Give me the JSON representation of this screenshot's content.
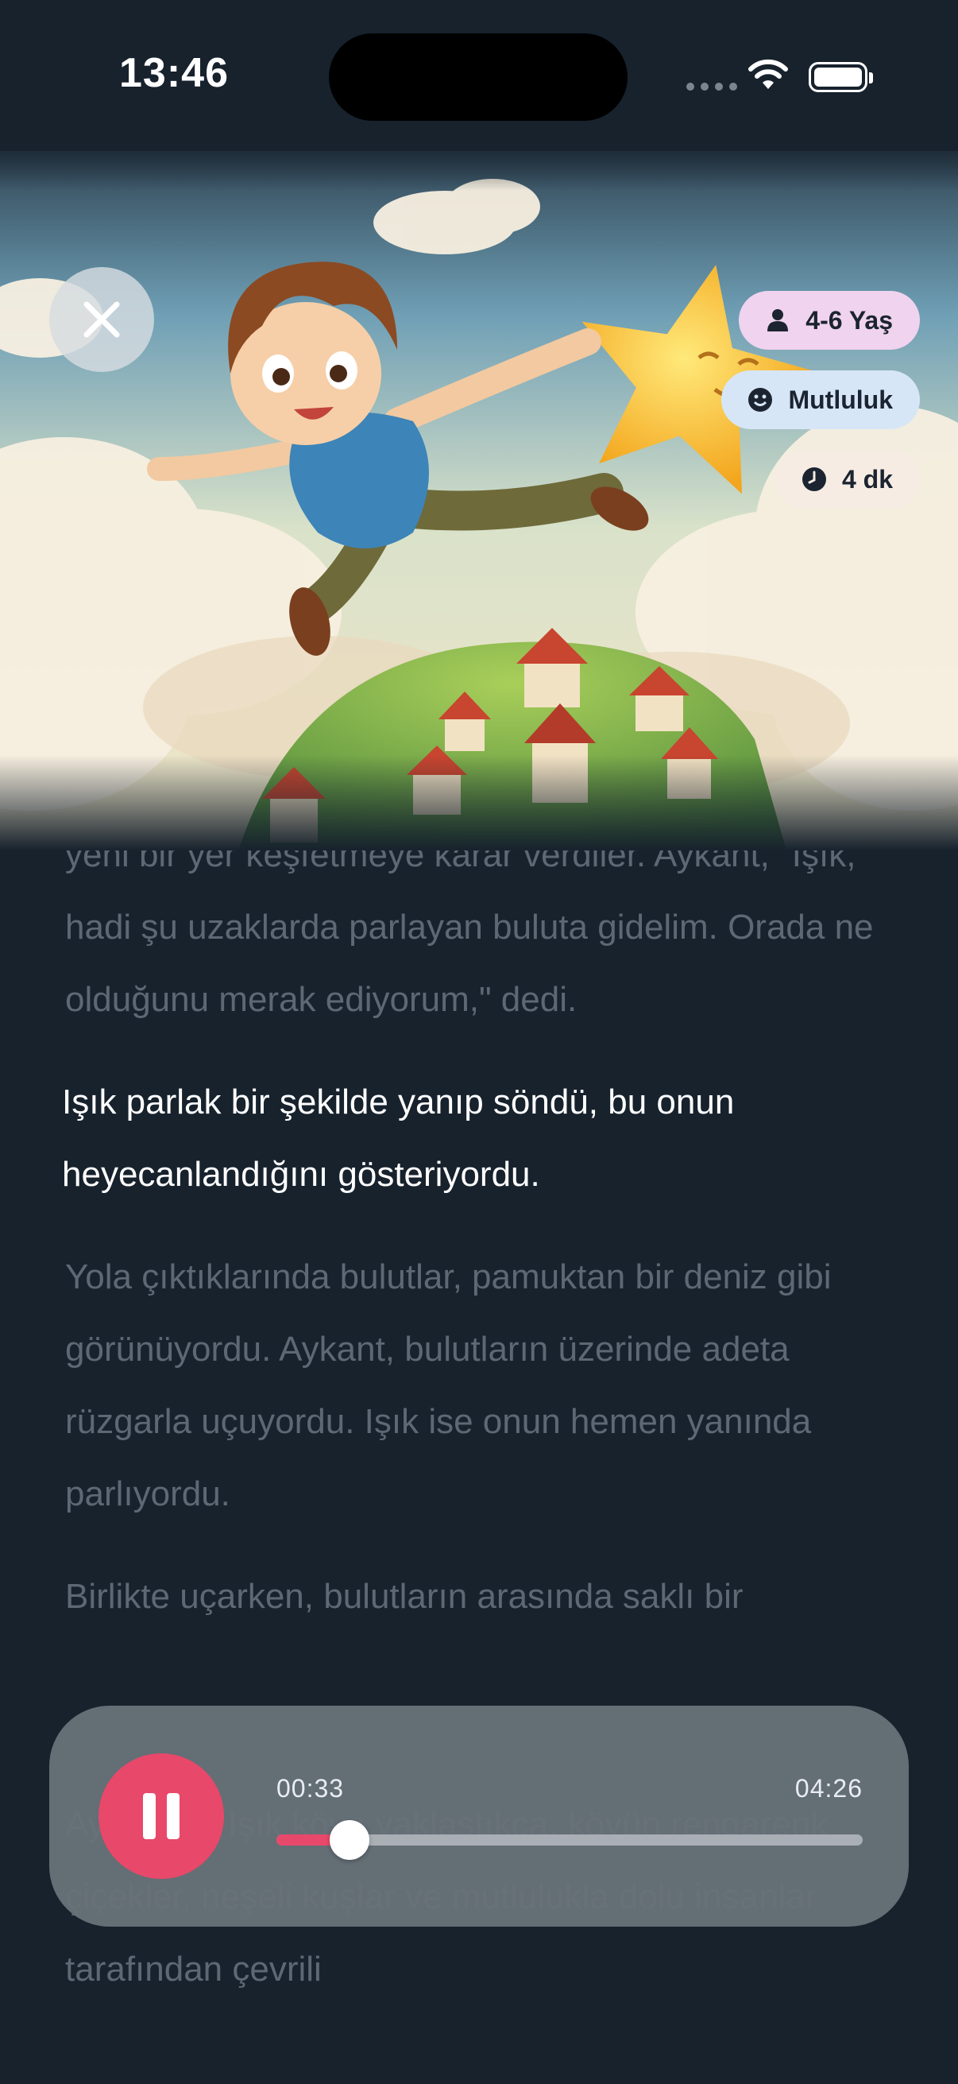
{
  "status_bar": {
    "time": "13:46"
  },
  "story": {
    "close_icon": "close-icon",
    "tags": [
      {
        "icon": "person-icon",
        "label": "4-6 Yaş"
      },
      {
        "icon": "smile-icon",
        "label": "Mutluluk"
      },
      {
        "icon": "clock-icon",
        "label": "4 dk"
      }
    ],
    "paragraphs": [
      "yeni bir yer keşfetmeye karar verdiler. Aykant, \"Işık, hadi şu uzaklarda parlayan buluta gidelim. Orada ne olduğunu merak ediyorum,\" dedi.",
      "Işık parlak bir şekilde yanıp söndü, bu onun heyecanlandığını gösteriyordu.",
      "Yola çıktıklarında bulutlar, pamuktan bir deniz gibi görünüyordu. Aykant, bulutların üzerinde adeta rüzgarla uçuyordu. Işık ise onun hemen yanında parlıyordu.",
      "Birlikte uçarken, bulutların arasında saklı bir",
      "Aykant ve Işık köye yaklaştıkça, köyün rengarenk çiçekler, neşeli kuşlar ve mutlulukla dolu insanlar tarafından çevrili"
    ]
  },
  "player": {
    "state": "playing",
    "pause_icon": "pause-icon",
    "current_time": "00:33",
    "total_time": "04:26",
    "progress": 0.124
  },
  "colors": {
    "background": "#17222d",
    "accent": "#e8486a",
    "tag_age": "#f0d3ee",
    "tag_mood": "#d6e6f7",
    "tag_duration": "#f6ece4"
  }
}
